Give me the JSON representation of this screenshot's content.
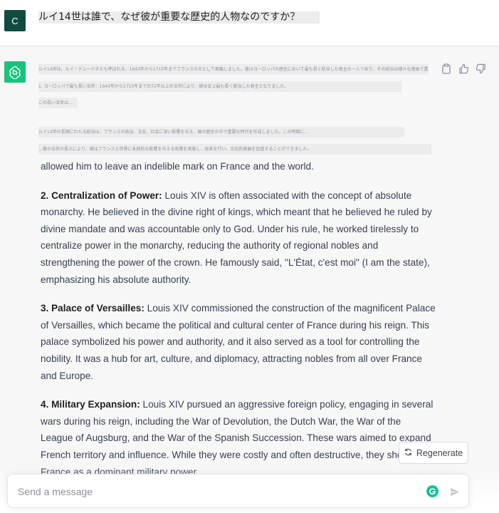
{
  "user": {
    "avatar_letter": "C",
    "message": "ルイ14世は誰で、なぜ彼が重要な歴史的人物なのですか？"
  },
  "assistant": {
    "faded_lines": [
      "ルイ14世は、ルイ・デュードネとも呼ばれる、1643年から1715年までフランスの王として君臨しました。彼はヨーロッパの歴史において最も長く統治した君主の一人であり、その統治は様々な理由で重要です。",
      "1. ヨーロッパで最も長い治世：1643年から1715年までの72年以上の治世により、彼は史上最も長く統治した君主となりました。",
      "この長い治世は…",
      "ルイ14世の長期にわたる統治は、フランスの政治、文化、社会に深い影響を与え、国の歴史の中で重要な時代を形成しました。この時期に…",
      "…彼の治世の長さにより、彼はフランスと世界に永続的な影響を与える政策を実施し、改革を行い、文化的発展を促進することができました。"
    ],
    "paragraph1_tail": "allowed him to leave an indelible mark on France and the world.",
    "points": [
      {
        "heading": "2. Centralization of Power:",
        "text": " Louis XIV is often associated with the concept of absolute monarchy. He believed in the divine right of kings, which meant that he believed he ruled by divine mandate and was accountable only to God. Under his rule, he worked tirelessly to centralize power in the monarchy, reducing the authority of regional nobles and strengthening the power of the crown. He famously said, \"L'État, c'est moi\" (I am the state), emphasizing his absolute authority."
      },
      {
        "heading": "3. Palace of Versailles:",
        "text": " Louis XIV commissioned the construction of the magnificent Palace of Versailles, which became the political and cultural center of France during his reign. This palace symbolized his power and authority, and it also served as a tool for controlling the nobility. It was a hub for art, culture, and diplomacy, attracting nobles from all over France and Europe."
      },
      {
        "heading": "4. Military Expansion:",
        "text": " Louis XIV pursued an aggressive foreign policy, engaging in several wars during his reign, including the War of Devolution, the Dutch War, the War of the League of Augsburg, and the War of the Spanish Succession. These wars aimed to expand French territory and influence. While they were costly and often destructive, they showcased France as a dominant military power."
      }
    ]
  },
  "actions": {
    "copy_icon": "clipboard-icon",
    "like_icon": "thumbs-up-icon",
    "dislike_icon": "thumbs-down-icon"
  },
  "regenerate_label": "Regenerate",
  "composer": {
    "placeholder": "Send a message"
  },
  "colors": {
    "brand": "#19c37d",
    "user_avatar": "#0f4c3f",
    "grammarly": "#15c39a"
  }
}
